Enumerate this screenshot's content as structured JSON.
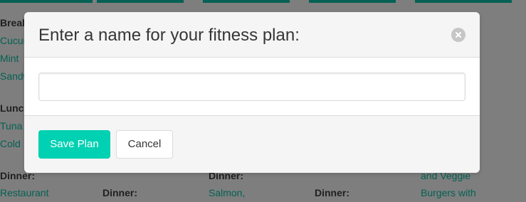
{
  "background": {
    "columns": [
      {
        "lines": [
          {
            "text": "Break",
            "kind": "label"
          },
          {
            "text": "Cucum",
            "kind": "link"
          },
          {
            "text": "Mint",
            "kind": "link"
          },
          {
            "text": "Sandw",
            "kind": "link"
          },
          {
            "text": "Lunch",
            "kind": "label"
          },
          {
            "text": "Tuna",
            "kind": "link"
          },
          {
            "text": "Cold",
            "kind": "link"
          },
          {
            "text": "Dinner:",
            "kind": "label"
          },
          {
            "text": "Restaurant",
            "kind": "link"
          }
        ]
      },
      {
        "lines": [
          {
            "text": "Dinner:",
            "kind": "label"
          }
        ]
      },
      {
        "lines": [
          {
            "text": "Dinner:",
            "kind": "label"
          },
          {
            "text": "Salmon,",
            "kind": "link"
          }
        ]
      },
      {
        "lines": [
          {
            "text": "Dinner:",
            "kind": "label"
          }
        ]
      },
      {
        "lines": [
          {
            "text": "and Veggie",
            "kind": "link"
          },
          {
            "text": "Burgers with",
            "kind": "link"
          }
        ]
      }
    ]
  },
  "modal": {
    "title": "Enter a name for your fitness plan:",
    "input": {
      "value": "",
      "placeholder": ""
    },
    "save_label": "Save Plan",
    "cancel_label": "Cancel",
    "close_icon": "close-icon"
  },
  "colors": {
    "accent": "#00d1b2",
    "link": "#00b89c"
  }
}
